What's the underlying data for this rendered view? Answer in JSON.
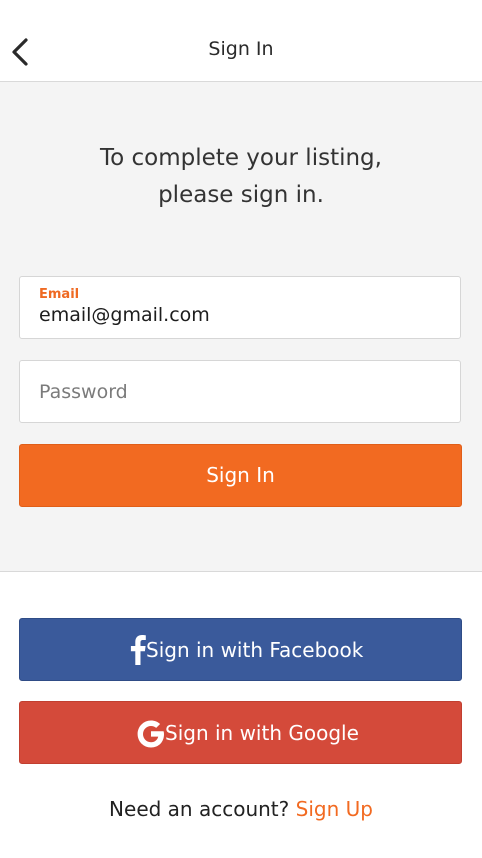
{
  "header": {
    "title": "Sign In",
    "back_icon": "chevron-left-icon"
  },
  "intro": {
    "line1": "To complete your listing,",
    "line2": "please sign in."
  },
  "form": {
    "email_label": "Email",
    "email_value": "email@gmail.com",
    "password_placeholder": "Password",
    "signin_label": "Sign In"
  },
  "social": {
    "facebook_label": "Sign in with Facebook",
    "google_label": "Sign in with Google",
    "facebook_icon": "facebook-icon",
    "google_icon": "google-icon"
  },
  "footer": {
    "prompt": "Need an account?",
    "link": "Sign Up"
  },
  "colors": {
    "accent": "#f26a21",
    "facebook": "#3a5a9b",
    "google": "#d44a3a",
    "panel_bg": "#f4f4f4"
  }
}
